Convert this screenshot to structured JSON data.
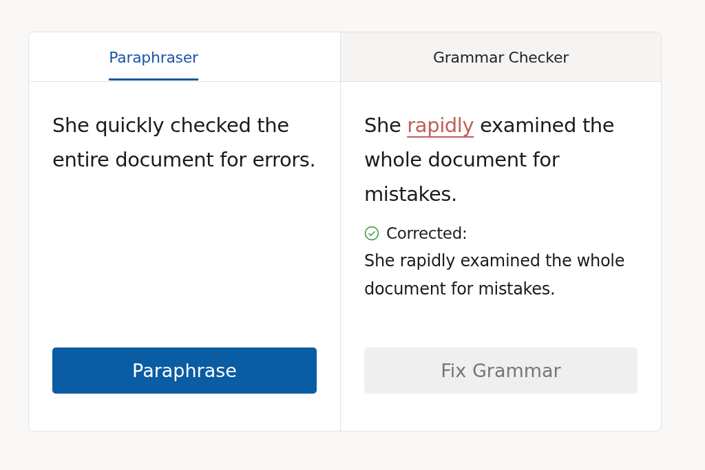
{
  "tabs": [
    {
      "label": "Paraphraser",
      "selected": true
    },
    {
      "label": "Grammar Checker",
      "selected": false
    }
  ],
  "panels": [
    {
      "parts": [
        {
          "text": "She quickly checked the entire document for errors.",
          "flagged": false
        }
      ],
      "button": {
        "label": "Paraphrase",
        "disabled": false
      }
    },
    {
      "parts": [
        {
          "text": "She ",
          "flagged": false
        },
        {
          "text": "rapidly",
          "flagged": true
        },
        {
          "text": " examined the whole document for mistakes.",
          "flagged": false
        }
      ],
      "result": {
        "label": "Corrected:",
        "text": "She rapidly examined the whole document for mistakes."
      },
      "button": {
        "label": "Fix Grammar",
        "disabled": true
      }
    }
  ]
}
